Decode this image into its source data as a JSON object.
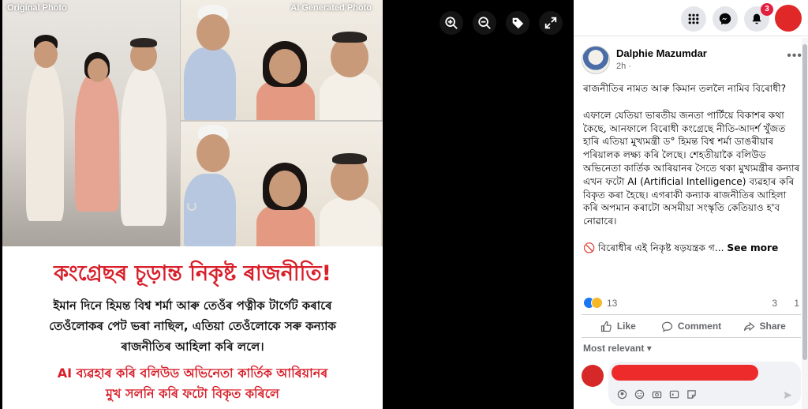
{
  "photo": {
    "label_original": "Original Photo",
    "label_ai": "AI Generated Photo",
    "caption_title": "কংগ্ৰেছৰ চূড়ান্ত নিকৃষ্ট ৰাজনীতি!",
    "caption_lines": [
      "ইমান দিনে হিমন্ত বিশ্ব শৰ্মা আৰু তেওঁৰ পত্নীক টাৰ্গেট কৰাৰে",
      "তেওঁলোকৰ পেট ভৰা নাছিল, এতিয়া তেওঁলোকে সৰু কন্যাক",
      "ৰাজনীতিৰ আহিলা কৰি ললে।"
    ],
    "caption_red_lines": [
      "AI ব্যৱহাৰ কৰি বলিউড অভিনেতা কাৰ্তিক আৰিয়ানৰ",
      "মুখ সলনি কৰি ফটো বিকৃত কৰিলে"
    ]
  },
  "viewer_tools": [
    "zoom-in-icon",
    "zoom-out-icon",
    "tag-icon",
    "fullscreen-icon"
  ],
  "nav": {
    "notification_count": "3",
    "accent": "#e41e3f"
  },
  "post": {
    "author": "Dalphie Mazumdar",
    "time": "2h ·",
    "more": "•••",
    "paragraph1": "ৰাজনীতিৰ নামত আৰু কিমান তললৈ নামিব বিৰোধী?",
    "paragraph2": "এফালে যেতিয়া ভাৰতীয় জনতা পাৰ্টিয়ে বিকাশৰ কথা কৈছে, আনফালে বিৰোধী কংগ্ৰেছে নীতি-আদৰ্শ খুঁজত হাৰি এতিয়া মুখ্যমন্ত্ৰী ড° হিমন্ত বিশ্ব শৰ্মা ডাঙৰীয়াৰ পৰিয়ালক লক্ষ্য কৰি লৈছে। শেহতীয়াকৈ বলিউড অভিনেতা কাৰ্তিক আৰিয়ানৰ সৈতে থকা মুখ্যমন্ত্ৰীৰ কন্যাৰ এখন ফটো AI (Artificial Intelligence) ব্যৱহাৰ কৰি বিকৃত কৰা হৈছে। এগৰাকী কন্যাক ৰাজনীতিৰ আহিলা কৰি অপমান কৰাটো অসমীয়া সংস্কৃতি কেতিয়াও হ'ব নোৱাৰে।",
    "paragraph3": "🚫 বিৰোধীৰ এই নিকৃষ্ট ষড়যন্ত্ৰক গ...",
    "see_more": "See more",
    "reaction_count": "13",
    "comment_count": "3",
    "share_count": "1",
    "like_label": "Like",
    "comment_label": "Comment",
    "share_label": "Share",
    "most_relevant": "Most relevant ▾"
  }
}
